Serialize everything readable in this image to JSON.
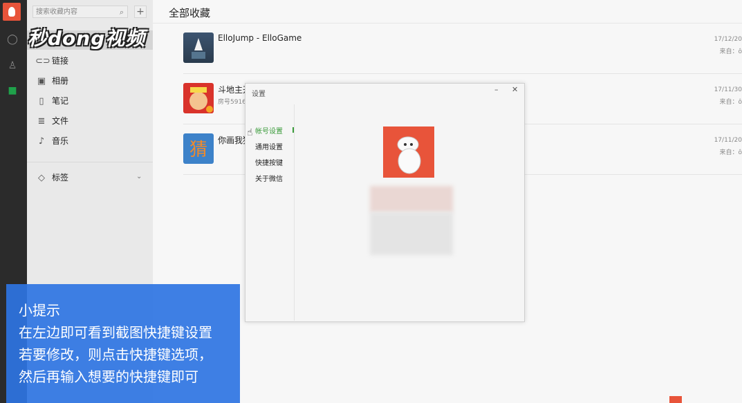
{
  "watermark": "秒dong视频",
  "search": {
    "placeholder": "搜索收藏内容",
    "icon": "search-icon"
  },
  "nav": {
    "items": [
      {
        "label": "链接",
        "icon": "link-icon",
        "glyph": "⊂⊃"
      },
      {
        "label": "相册",
        "icon": "image-icon",
        "glyph": "▣"
      },
      {
        "label": "笔记",
        "icon": "note-icon",
        "glyph": "▯"
      },
      {
        "label": "文件",
        "icon": "file-icon",
        "glyph": "≣"
      },
      {
        "label": "音乐",
        "icon": "music-icon",
        "glyph": "♪"
      }
    ],
    "tags": {
      "label": "标签",
      "icon": "tag-icon",
      "glyph": "◇"
    }
  },
  "main": {
    "title": "全部收藏",
    "rows": [
      {
        "title": "ElloJump - ElloGame",
        "sub": "",
        "date": "17/12/20",
        "source": "来自：ô"
      },
      {
        "title": "斗地主开",
        "sub": "房号5916",
        "date": "17/11/30",
        "source": "来自：ô"
      },
      {
        "title": "你画我猜",
        "sub": "",
        "date": "17/11/20",
        "source": "来自：ô"
      }
    ]
  },
  "dialog": {
    "title": "设置",
    "min": "–",
    "close": "✕",
    "menu": [
      {
        "label": "帐号设置",
        "active": true
      },
      {
        "label": "通用设置",
        "active": false
      },
      {
        "label": "快捷按键",
        "active": false
      },
      {
        "label": "关于微信",
        "active": false
      }
    ]
  },
  "tip": {
    "lines": [
      "小提示",
      "在左边即可看到截图快捷键设置",
      "若要修改，则点击快捷键选项，",
      "然后再输入想要的快捷键即可"
    ]
  },
  "colors": {
    "accent_green": "#3a9b3a",
    "avatar_orange": "#e8543a",
    "tip_blue": "#2e74e2"
  }
}
